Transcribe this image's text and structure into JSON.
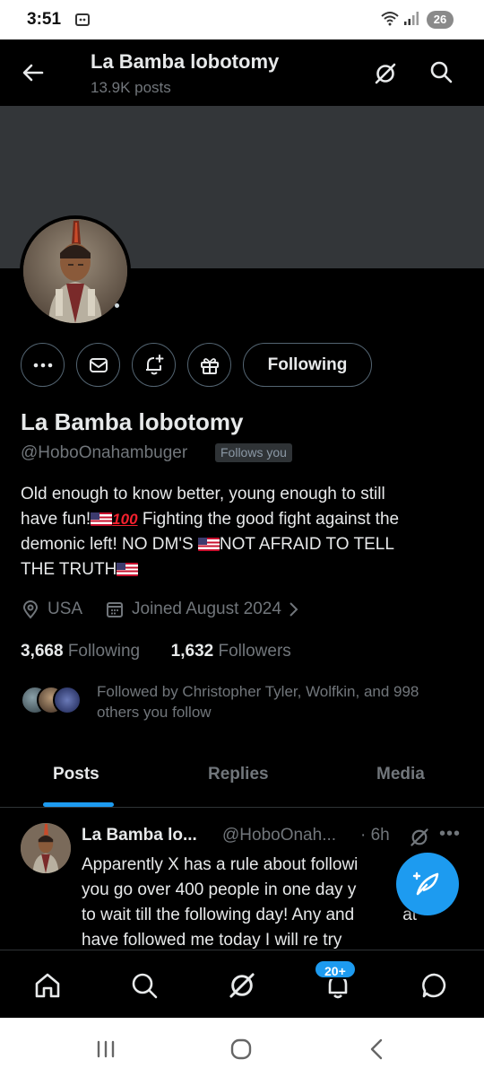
{
  "status_bar": {
    "time": "3:51",
    "battery": "26"
  },
  "header": {
    "title": "La Bamba lobotomy",
    "posts_count": "13.9K posts"
  },
  "profile": {
    "following_button": "Following",
    "display_name": "La Bamba lobotomy",
    "handle": "@HoboOnahambuger",
    "follows_you": "Follows you",
    "bio_line1": "Old enough to know better, young enough to still",
    "bio_line2_a": "have fun!",
    "bio_line2_b": " Fighting the good fight against the",
    "bio_line3_a": "demonic left! NO DM'S ",
    "bio_line3_b": "NOT AFRAID TO TELL",
    "bio_line4": "THE TRUTH",
    "hundred_emoji": "100",
    "location": "USA",
    "joined": "Joined August 2024",
    "following_count": "3,668",
    "following_label": "Following",
    "followers_count": "1,632",
    "followers_label": "Followers",
    "followed_by_line1": "Followed by Christopher Tyler, Wolfkin, and 998",
    "followed_by_line2": "others you follow"
  },
  "tabs": [
    {
      "label": "Posts",
      "active": true
    },
    {
      "label": "Replies",
      "active": false
    },
    {
      "label": "Media",
      "active": false
    }
  ],
  "post": {
    "name": "La Bamba lo...",
    "handle": "@HoboOnah...",
    "time": "· 6h",
    "text_line1": "Apparently X has a rule about followi",
    "text_line2": "you go over 400 people in one day y",
    "text_line3": "to wait till the following day! Any and",
    "text_line3b": "at",
    "text_line4": "have followed me today I will re try"
  },
  "bottom_nav": {
    "items": [
      "home-icon",
      "search-icon",
      "grok-icon",
      "notifications-icon",
      "messages-icon"
    ],
    "notifications_badge": "20+"
  },
  "colors": {
    "accent": "#1d9bf0",
    "muted": "#71767b",
    "text": "#e7e9ea",
    "banner": "#333639"
  }
}
